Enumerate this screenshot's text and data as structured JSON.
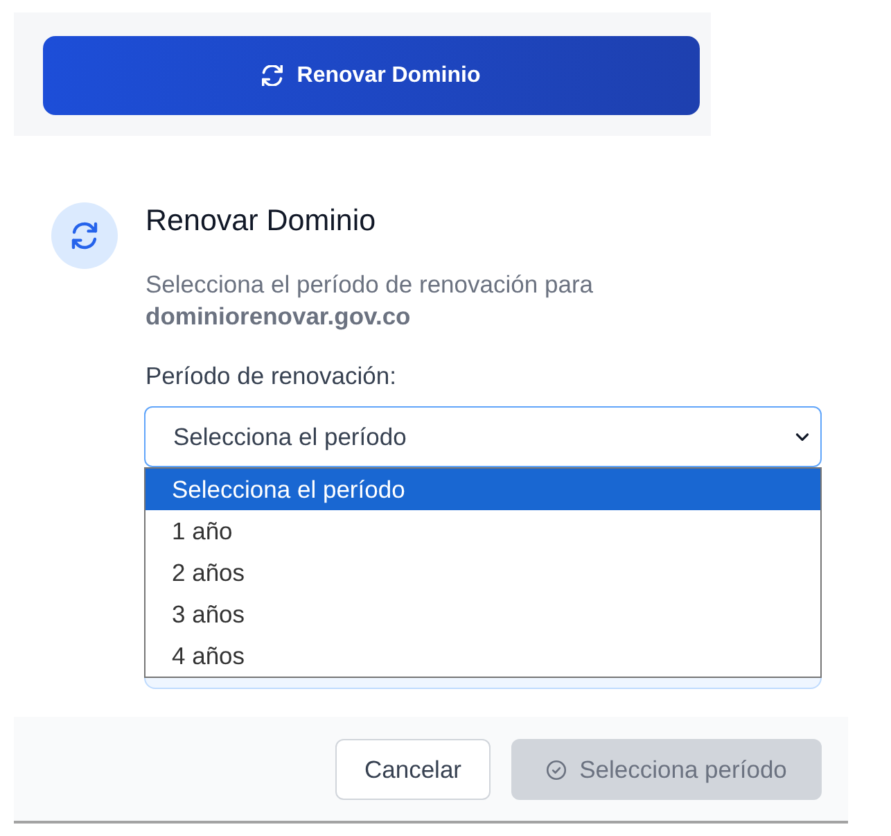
{
  "trigger_button": {
    "label": "Renovar Dominio"
  },
  "dialog": {
    "title": "Renovar Dominio",
    "description": "Selecciona el período de renovación para **dominiorenovar.gov.co**",
    "field": {
      "label": "Período de renovación:",
      "value": "Selecciona el período",
      "expanded": true,
      "options": [
        {
          "label": "Selecciona el período",
          "selected": true
        },
        {
          "label": "1 año",
          "selected": false
        },
        {
          "label": "2 años",
          "selected": false
        },
        {
          "label": "3 años",
          "selected": false
        },
        {
          "label": "4 años",
          "selected": false
        }
      ]
    },
    "buttons": [
      {
        "label": "Cancelar",
        "kind": "secondary",
        "disabled": false
      },
      {
        "label": "Selecciona período",
        "kind": "primary",
        "disabled": true
      }
    ]
  }
}
